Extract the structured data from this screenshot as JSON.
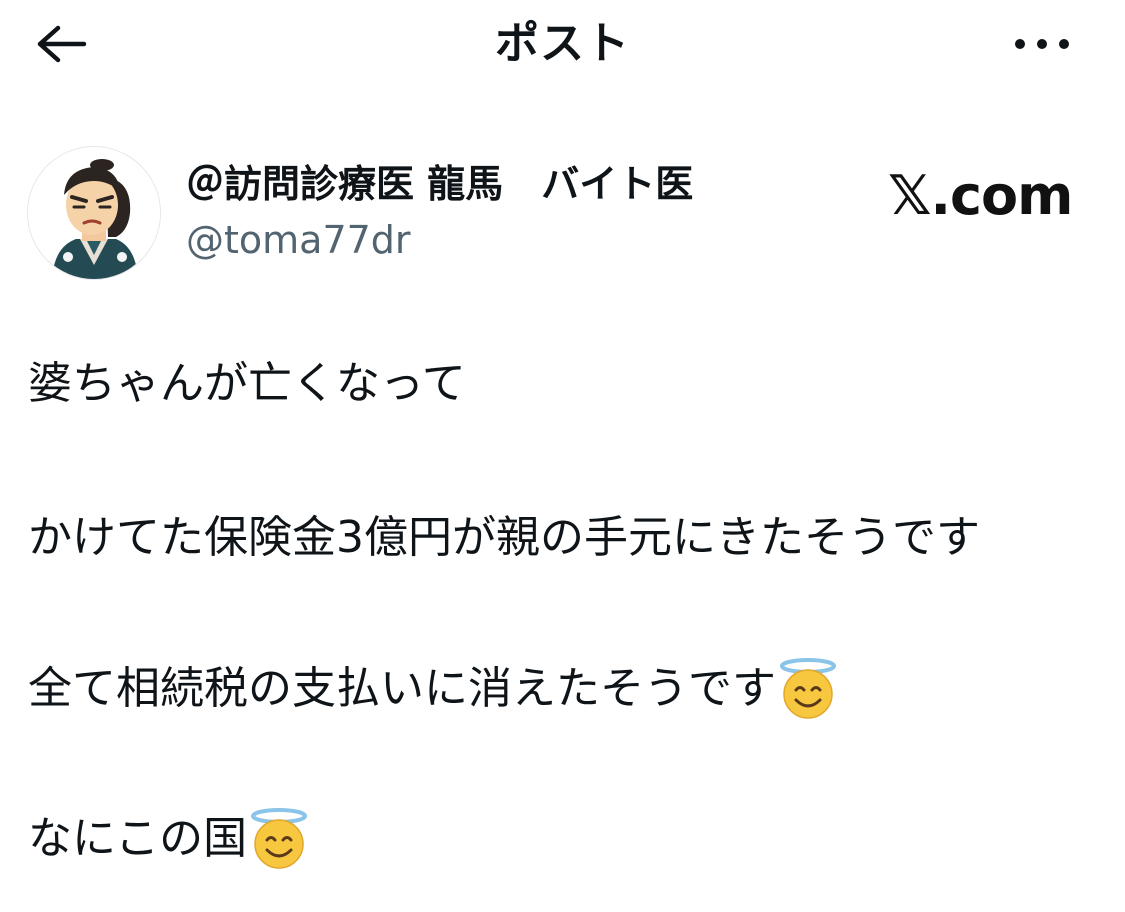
{
  "header": {
    "title": "ポスト",
    "back_icon": "arrow-left-icon",
    "more_icon": "more-horizontal-icon"
  },
  "author": {
    "display_name": "＠訪問診療医 龍馬　バイト医",
    "handle": "@toma77dr",
    "avatar_icon": "samurai-illustration-avatar"
  },
  "watermark": {
    "text": "𝕏.com"
  },
  "post": {
    "lines": [
      "婆ちゃんが亡くなって",
      "かけてた保険金3億円が親の手元にきたそうです",
      "全て相続税の支払いに消えたそうです",
      "なにこの国"
    ],
    "emoji": "smiling-face-with-halo"
  },
  "colors": {
    "text": "#0f1419",
    "secondary": "#536471",
    "background": "#ffffff"
  }
}
